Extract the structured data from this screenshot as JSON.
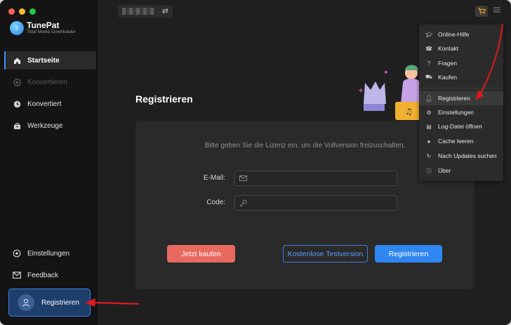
{
  "app": {
    "name": "TunePat",
    "subtitle": "Tidal Media Downloader"
  },
  "sidebar": {
    "items": [
      {
        "label": "Startseite",
        "icon": "home-icon",
        "state": "active"
      },
      {
        "label": "Konvertieren",
        "icon": "convert-icon",
        "state": "disabled"
      },
      {
        "label": "Konvertiert",
        "icon": "clock-icon",
        "state": "normal"
      },
      {
        "label": "Werkzeuge",
        "icon": "toolbox-icon",
        "state": "normal"
      }
    ],
    "bottom_items": [
      {
        "label": "Einstellungen",
        "icon": "gear-icon"
      },
      {
        "label": "Feedback",
        "icon": "mail-icon"
      }
    ],
    "register_label": "Registrieren"
  },
  "main": {
    "title": "Registrieren",
    "description": "Bitte geben Sie die Lizenz ein, um die Vollversion freizuschalten.",
    "email_label": "E-Mail:",
    "code_label": "Code:",
    "email_value": "",
    "code_value": "",
    "buy_label": "Jetzt kaufen",
    "trial_label": "Kostenlose Testversion",
    "register_label": "Registrieren"
  },
  "menu": {
    "items": [
      {
        "label": "Online-Hilfe",
        "icon": "graduation-cap-icon"
      },
      {
        "label": "Kontakt",
        "icon": "phone-icon"
      },
      {
        "label": "Fragen",
        "icon": "question-icon"
      },
      {
        "label": "Kaufen",
        "icon": "cart-icon"
      },
      {
        "label": "Registrieren",
        "icon": "user-key-icon",
        "highlighted": true
      },
      {
        "label": "Einstellungen",
        "icon": "gear-icon"
      },
      {
        "label": "Log-Datei öffnen",
        "icon": "file-icon"
      },
      {
        "label": "Cache leeren",
        "icon": "broom-icon"
      },
      {
        "label": "Nach Updates suchen",
        "icon": "refresh-icon"
      },
      {
        "label": "Über",
        "icon": "info-icon"
      }
    ]
  },
  "colors": {
    "accent": "#2f86f0",
    "buy": "#e86a5f",
    "annotation_arrow": "#e0191f",
    "cart_icon": "#f0a020"
  }
}
